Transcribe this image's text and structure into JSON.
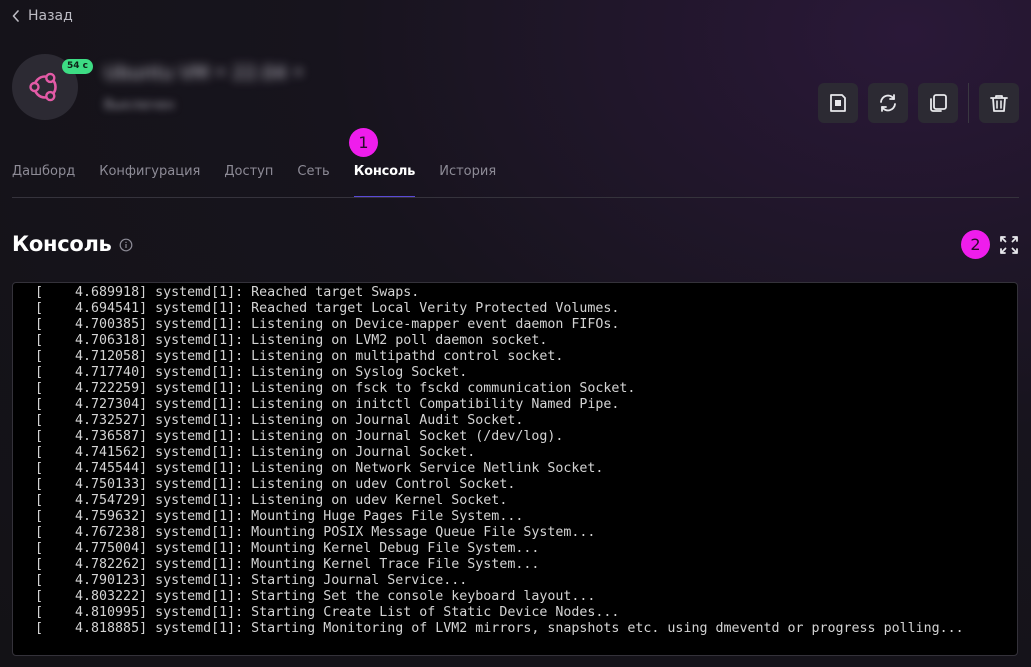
{
  "nav": {
    "back_label": "Назад"
  },
  "vm": {
    "status_badge": "54 с",
    "name": "Ubuntu VM • 22.04 •",
    "subtitle": "Выключен"
  },
  "actions": [
    {
      "name": "stop-button",
      "icon": "stop-icon"
    },
    {
      "name": "reboot-button",
      "icon": "refresh-icon"
    },
    {
      "name": "clone-button",
      "icon": "copy-icon"
    },
    {
      "name": "delete-button",
      "icon": "trash-icon"
    }
  ],
  "tabs": [
    {
      "label": "Дашборд",
      "active": false
    },
    {
      "label": "Конфигурация",
      "active": false
    },
    {
      "label": "Доступ",
      "active": false
    },
    {
      "label": "Сеть",
      "active": false
    },
    {
      "label": "Консоль",
      "active": true
    },
    {
      "label": "История",
      "active": false
    }
  ],
  "markers": [
    "1",
    "2"
  ],
  "section": {
    "title": "Консоль"
  },
  "console": {
    "lines": [
      "[    4.689918] systemd[1]: Reached target Swaps.",
      "[    4.694541] systemd[1]: Reached target Local Verity Protected Volumes.",
      "[    4.700385] systemd[1]: Listening on Device-mapper event daemon FIFOs.",
      "[    4.706318] systemd[1]: Listening on LVM2 poll daemon socket.",
      "[    4.712058] systemd[1]: Listening on multipathd control socket.",
      "[    4.717740] systemd[1]: Listening on Syslog Socket.",
      "[    4.722259] systemd[1]: Listening on fsck to fsckd communication Socket.",
      "[    4.727304] systemd[1]: Listening on initctl Compatibility Named Pipe.",
      "[    4.732527] systemd[1]: Listening on Journal Audit Socket.",
      "[    4.736587] systemd[1]: Listening on Journal Socket (/dev/log).",
      "[    4.741562] systemd[1]: Listening on Journal Socket.",
      "[    4.745544] systemd[1]: Listening on Network Service Netlink Socket.",
      "[    4.750133] systemd[1]: Listening on udev Control Socket.",
      "[    4.754729] systemd[1]: Listening on udev Kernel Socket.",
      "[    4.759632] systemd[1]: Mounting Huge Pages File System...",
      "[    4.767238] systemd[1]: Mounting POSIX Message Queue File System...",
      "[    4.775004] systemd[1]: Mounting Kernel Debug File System...",
      "[    4.782262] systemd[1]: Mounting Kernel Trace File System...",
      "[    4.790123] systemd[1]: Starting Journal Service...",
      "[    4.803222] systemd[1]: Starting Set the console keyboard layout...",
      "[    4.810995] systemd[1]: Starting Create List of Static Device Nodes...",
      "[    4.818885] systemd[1]: Starting Monitoring of LVM2 mirrors, snapshots etc. using dmeventd or progress polling..."
    ]
  },
  "colors": {
    "accent": "#5a4ad6",
    "marker": "#ef1dec",
    "status_ok": "#3ddc84",
    "ubuntu": "#e35aa6"
  }
}
